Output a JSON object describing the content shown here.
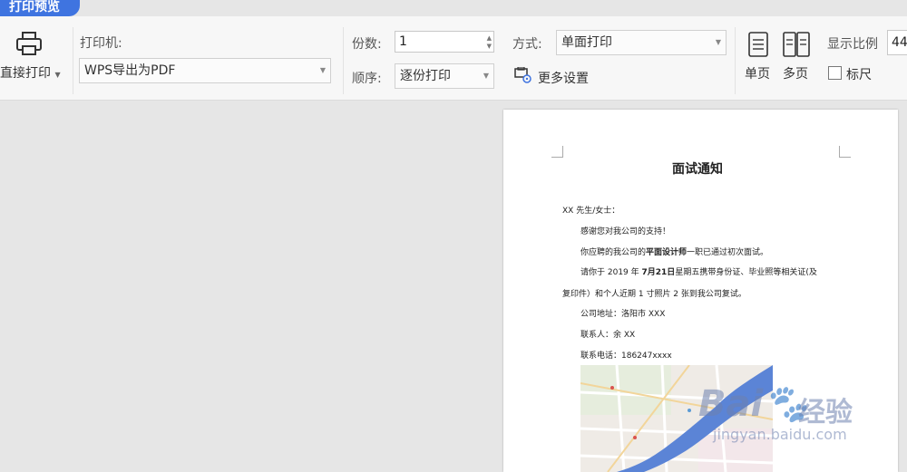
{
  "tab": {
    "title": "打印预览"
  },
  "toolbar": {
    "direct_print": "直接打印",
    "printer_label": "打印机:",
    "printer_value": "WPS导出为PDF",
    "copies_label": "份数:",
    "copies_value": "1",
    "order_label": "顺序:",
    "order_value": "逐份打印",
    "mode_label": "方式:",
    "mode_value": "单面打印",
    "more_settings": "更多设置",
    "single_page": "单页",
    "multi_page": "多页",
    "zoom_label": "显示比例",
    "zoom_value": "44",
    "ruler_label": "标尺"
  },
  "document": {
    "title": "面试通知",
    "greeting": "XX 先生/女士：",
    "line1": "感谢您对我公司的支持！",
    "line2_pre": "你应聘的我公司的",
    "line2_bold": "平面设计师",
    "line2_post": "一职已通过初次面试。",
    "line3_pre": "请你于 2019 年",
    "line3_bold": "7月21日",
    "line3_post": "星期五携带身份证、毕业照等相关证(及",
    "line4": "复印件）和个人近期 1 寸照片 2 张到我公司复试。",
    "address": "公司地址：洛阳市 XXX",
    "contact": "联系人：余 XX",
    "phone": "联系电话：186247xxxx"
  },
  "watermark": {
    "brand": "Bai",
    "brand2": "经验",
    "url": "jingyan.baidu.com"
  },
  "colors": {
    "accent": "#3f74e0",
    "river": "#5b84d6"
  }
}
